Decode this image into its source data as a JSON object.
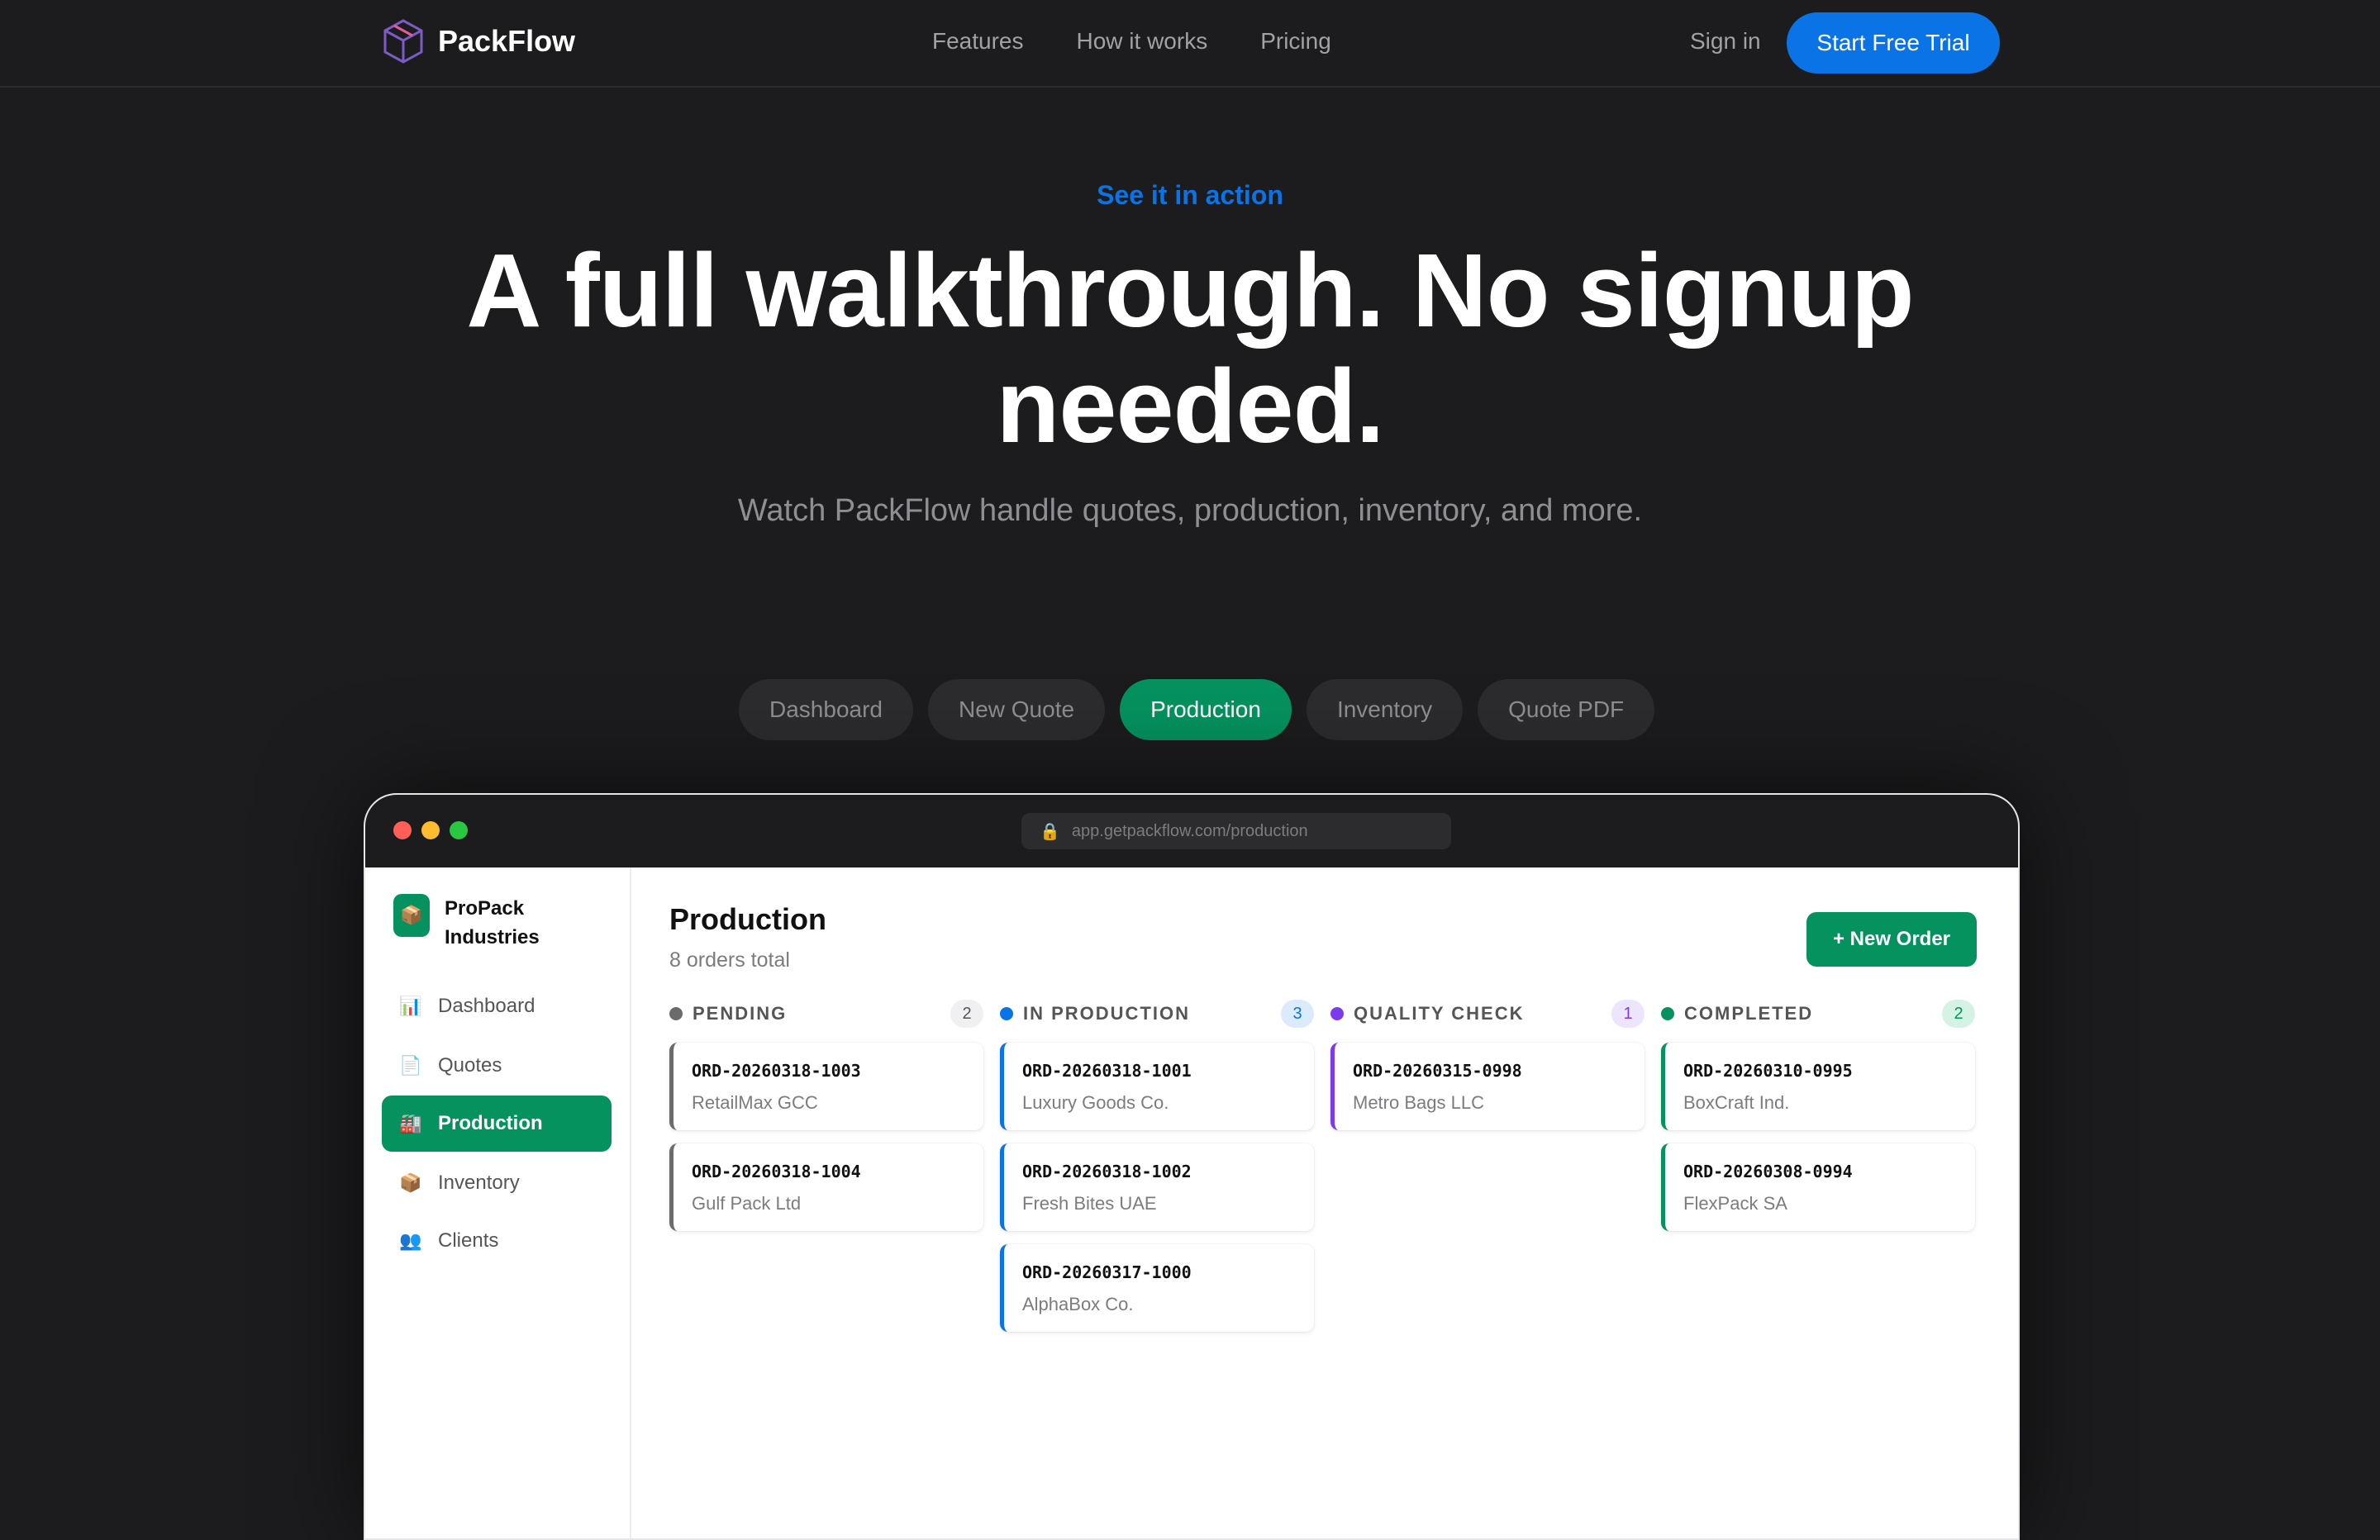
{
  "nav": {
    "brand": "PackFlow",
    "links": [
      "Features",
      "How it works",
      "Pricing"
    ],
    "signin": "Sign in",
    "cta": "Start Free Trial"
  },
  "hero": {
    "eyebrow": "See it in action",
    "headline": "A full walkthrough. No signup needed.",
    "subline": "Watch PackFlow handle quotes, production, inventory, and more."
  },
  "tabs": [
    {
      "label": "Dashboard",
      "active": false
    },
    {
      "label": "New Quote",
      "active": false
    },
    {
      "label": "Production",
      "active": true
    },
    {
      "label": "Inventory",
      "active": false
    },
    {
      "label": "Quote PDF",
      "active": false
    }
  ],
  "browser": {
    "url": "app.getpackflow.com/production",
    "lock_icon": "lock-icon",
    "traffic_lights": [
      "#ff5f57",
      "#febc2e",
      "#28c840"
    ]
  },
  "app": {
    "company": "ProPack Industries",
    "company_icon": "package-icon",
    "sidebar": [
      {
        "label": "Dashboard",
        "icon": "bar-chart-icon",
        "glyph": "📊",
        "active": false
      },
      {
        "label": "Quotes",
        "icon": "document-icon",
        "glyph": "📄",
        "active": false
      },
      {
        "label": "Production",
        "icon": "factory-icon",
        "glyph": "🏭",
        "active": true
      },
      {
        "label": "Inventory",
        "icon": "package-icon",
        "glyph": "📦",
        "active": false
      },
      {
        "label": "Clients",
        "icon": "people-icon",
        "glyph": "👥",
        "active": false
      }
    ],
    "page_title": "Production",
    "page_subtitle": "8 orders total",
    "new_order": "+ New Order",
    "columns": [
      {
        "title": "PENDING",
        "count": "2",
        "color": "#6b6b6b",
        "badge_bg": "#f0f0f2",
        "badge_fg": "#555555",
        "cards": [
          {
            "id": "ORD-20260318-1003",
            "client": "RetailMax GCC"
          },
          {
            "id": "ORD-20260318-1004",
            "client": "Gulf Pack Ltd"
          }
        ]
      },
      {
        "title": "IN PRODUCTION",
        "count": "3",
        "color": "#0a74e6",
        "badge_bg": "#dcebfb",
        "badge_fg": "#0a74e6",
        "cards": [
          {
            "id": "ORD-20260318-1001",
            "client": "Luxury Goods Co."
          },
          {
            "id": "ORD-20260318-1002",
            "client": "Fresh Bites UAE"
          },
          {
            "id": "ORD-20260317-1000",
            "client": "AlphaBox Co."
          }
        ]
      },
      {
        "title": "QUALITY CHECK",
        "count": "1",
        "color": "#7c3aed",
        "badge_bg": "#ede4fd",
        "badge_fg": "#7c3aed",
        "cards": [
          {
            "id": "ORD-20260315-0998",
            "client": "Metro Bags LLC"
          }
        ]
      },
      {
        "title": "COMPLETED",
        "count": "2",
        "color": "#05925f",
        "badge_bg": "#d5f3e5",
        "badge_fg": "#05925f",
        "cards": [
          {
            "id": "ORD-20260310-0995",
            "client": "BoxCraft Ind."
          },
          {
            "id": "ORD-20260308-0994",
            "client": "FlexPack SA"
          }
        ]
      }
    ]
  }
}
